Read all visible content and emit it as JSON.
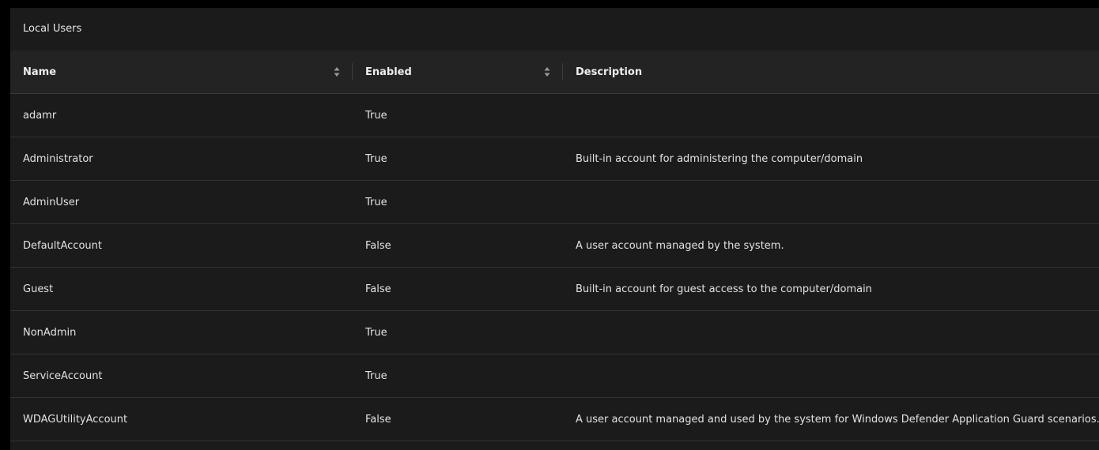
{
  "panel": {
    "title": "Local Users"
  },
  "table": {
    "columns": [
      {
        "key": "name",
        "label": "Name",
        "sortable": true,
        "sort_icon": "sort-updown-icon"
      },
      {
        "key": "enabled",
        "label": "Enabled",
        "sortable": true,
        "sort_icon": "sort-updown-icon"
      },
      {
        "key": "description",
        "label": "Description",
        "sortable": false
      }
    ],
    "rows": [
      {
        "name": "adamr",
        "enabled": "True",
        "description": ""
      },
      {
        "name": "Administrator",
        "enabled": "True",
        "description": "Built-in account for administering the computer/domain"
      },
      {
        "name": "AdminUser",
        "enabled": "True",
        "description": ""
      },
      {
        "name": "DefaultAccount",
        "enabled": "False",
        "description": "A user account managed by the system."
      },
      {
        "name": "Guest",
        "enabled": "False",
        "description": "Built-in account for guest access to the computer/domain"
      },
      {
        "name": "NonAdmin",
        "enabled": "True",
        "description": ""
      },
      {
        "name": "ServiceAccount",
        "enabled": "True",
        "description": ""
      },
      {
        "name": "WDAGUtilityAccount",
        "enabled": "False",
        "description": "A user account managed and used by the system for Windows Defender Application Guard scenarios."
      }
    ]
  },
  "colors": {
    "page_background": "#000000",
    "panel_background": "#1b1b1c",
    "header_background": "#232324",
    "row_divider": "#333333",
    "text": "#e2e2e2"
  }
}
